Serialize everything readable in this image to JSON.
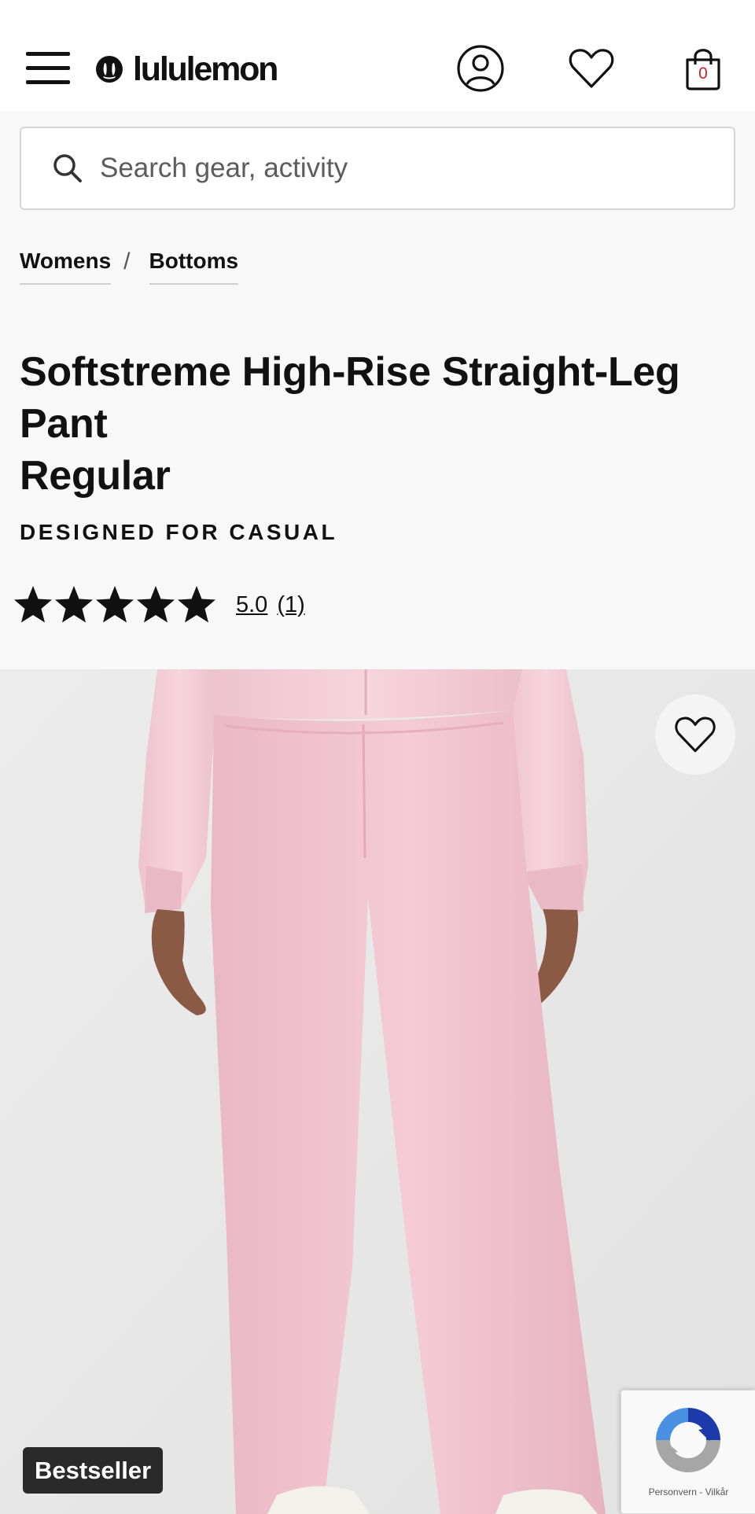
{
  "header": {
    "brand": "lululemon",
    "bag_count": "0",
    "icons": [
      "menu-icon",
      "account-icon",
      "heart-icon",
      "shopping-bag-icon"
    ]
  },
  "search": {
    "placeholder": "Search gear, activity",
    "value": ""
  },
  "breadcrumb": {
    "items": [
      "Womens",
      "Bottoms"
    ],
    "separator": "/"
  },
  "product": {
    "title_lines": [
      "Softstreme High-Rise Straight-Leg",
      "Pant",
      "Regular"
    ],
    "activity": "DESIGNED FOR CASUAL",
    "rating": {
      "stars": 5,
      "max_stars": 5,
      "score": "5.0",
      "count": "(1)"
    },
    "badge": "Bestseller",
    "colors": {
      "pant": "#f2c6d1",
      "background": "#e6e6e6",
      "bag_count": "#d22030"
    }
  },
  "recaptcha": {
    "links": "Personvern - Vilkår"
  }
}
